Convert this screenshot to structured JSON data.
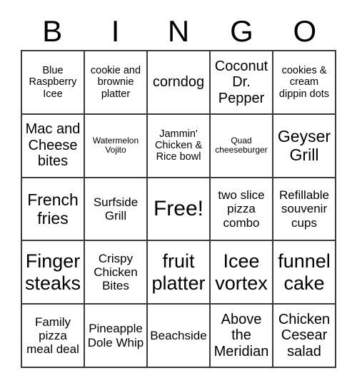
{
  "card": {
    "title_letters": [
      "B",
      "I",
      "N",
      "G",
      "O"
    ],
    "free_space": "Free!",
    "columns": 5,
    "rows": 5,
    "border_color": "#3a3a3a",
    "background_color": "#ffffff",
    "text_color": "#000000",
    "cells": [
      [
        {
          "text": "Blue Raspberry Icee",
          "size": "s"
        },
        {
          "text": "cookie and brownie platter",
          "size": "s"
        },
        {
          "text": "corndog",
          "size": "l"
        },
        {
          "text": "Coconut Dr. Pepper",
          "size": "l"
        },
        {
          "text": "cookies & cream dippin dots",
          "size": "s"
        }
      ],
      [
        {
          "text": "Mac and Cheese bites",
          "size": "l"
        },
        {
          "text": "Watermelon Vojito",
          "size": "xs"
        },
        {
          "text": "Jammin' Chicken & Rice bowl",
          "size": "s"
        },
        {
          "text": "Quad cheeseburger",
          "size": "xs"
        },
        {
          "text": "Geyser Grill",
          "size": "xl"
        }
      ],
      [
        {
          "text": "French fries",
          "size": "xl"
        },
        {
          "text": "Surfside Grill",
          "size": "m"
        },
        {
          "text": "Free!",
          "size": "free"
        },
        {
          "text": "two slice pizza combo",
          "size": "m"
        },
        {
          "text": "Refillable souvenir cups",
          "size": "m"
        }
      ],
      [
        {
          "text": "Finger steaks",
          "size": "xxl"
        },
        {
          "text": "Crispy Chicken Bites",
          "size": "m"
        },
        {
          "text": "fruit platter",
          "size": "xxl"
        },
        {
          "text": "Icee vortex",
          "size": "xxl"
        },
        {
          "text": "funnel cake",
          "size": "xxl"
        }
      ],
      [
        {
          "text": "Family pizza meal deal",
          "size": "m"
        },
        {
          "text": "Pineapple Dole Whip",
          "size": "m"
        },
        {
          "text": "Beachside",
          "size": "m"
        },
        {
          "text": "Above the Meridian",
          "size": "l"
        },
        {
          "text": "Chicken Cesear salad",
          "size": "l"
        }
      ]
    ]
  }
}
